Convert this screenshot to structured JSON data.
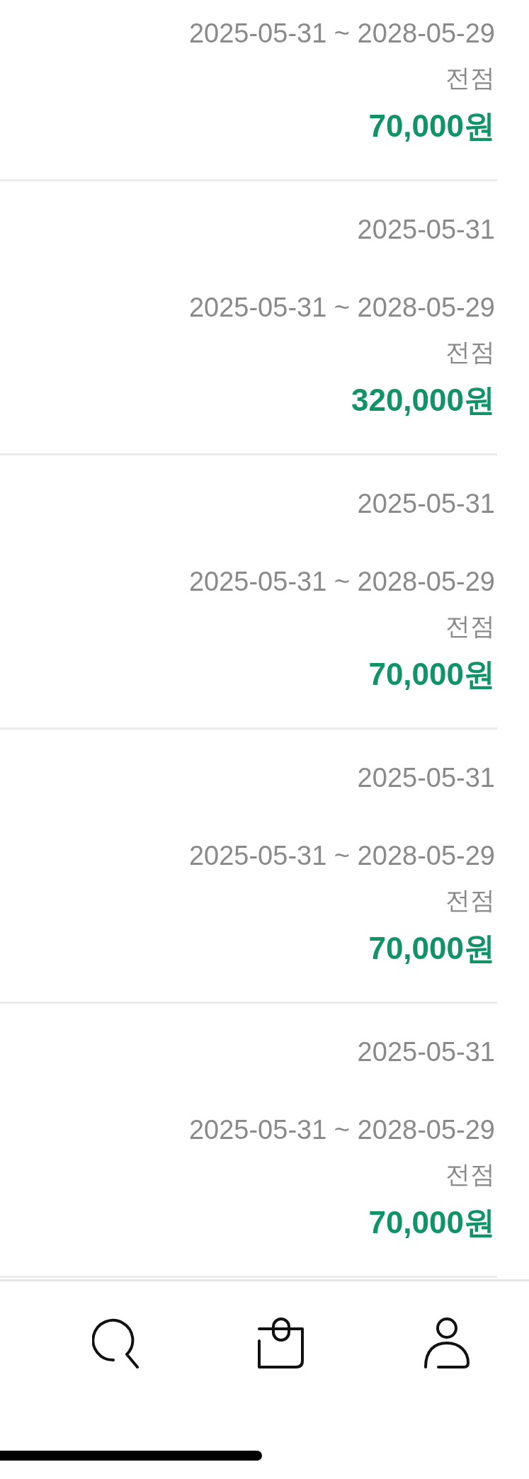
{
  "items": [
    {
      "validity": "2025-05-31 ~ 2028-05-29",
      "store": "전점",
      "amount": "70,000원"
    },
    {
      "date": "2025-05-31",
      "validity": "2025-05-31 ~ 2028-05-29",
      "store": "전점",
      "amount": "320,000원"
    },
    {
      "date": "2025-05-31",
      "validity": "2025-05-31 ~ 2028-05-29",
      "store": "전점",
      "amount": "70,000원"
    },
    {
      "date": "2025-05-31",
      "validity": "2025-05-31 ~ 2028-05-29",
      "store": "전점",
      "amount": "70,000원"
    },
    {
      "date": "2025-05-31",
      "validity": "2025-05-31 ~ 2028-05-29",
      "store": "전점",
      "amount": "70,000원"
    }
  ],
  "bottom_nav": {
    "items": [
      {
        "kind": "search"
      },
      {
        "kind": "bag"
      },
      {
        "kind": "profile"
      }
    ]
  }
}
